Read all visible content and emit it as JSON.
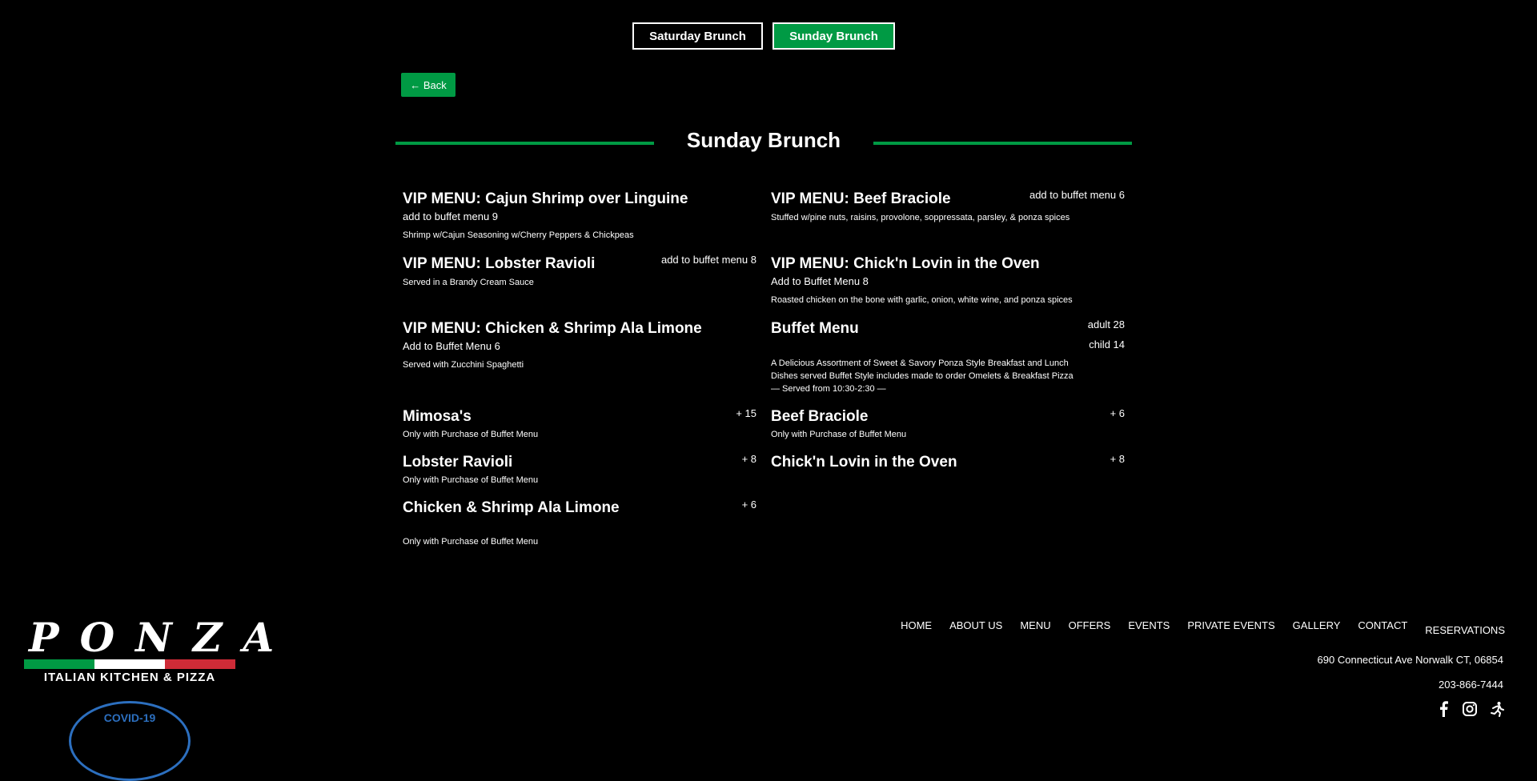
{
  "tabs": {
    "saturday": "Saturday Brunch",
    "sunday": "Sunday Brunch"
  },
  "back_label": "← Back",
  "page_title": "Sunday Brunch",
  "items": {
    "cajun": {
      "title": "VIP MENU: Cajun Shrimp over Linguine",
      "sub": "add to buffet menu  9",
      "desc": "Shrimp w/Cajun Seasoning w/Cherry Peppers & Chickpeas"
    },
    "beef_vip": {
      "title": "VIP MENU: Beef Braciole",
      "price": "add to buffet menu  6",
      "desc": "Stuffed w/pine nuts, raisins, provolone, soppressata, parsley, & ponza spices"
    },
    "lobster_vip": {
      "title": "VIP MENU: Lobster Ravioli",
      "price": "add to buffet menu  8",
      "desc": "Served in a Brandy Cream Sauce"
    },
    "chickn_vip": {
      "title": "VIP MENU: Chick'n Lovin in the Oven",
      "sub": "Add to Buffet Menu  8",
      "desc": "Roasted chicken on the bone with garlic, onion, white wine, and ponza spices"
    },
    "limone_vip": {
      "title": "VIP MENU: Chicken & Shrimp Ala Limone",
      "sub": "Add to Buffet Menu  6",
      "desc": "Served with Zucchini Spaghetti"
    },
    "buffet": {
      "title": "Buffet Menu",
      "adult": "adult  28",
      "child": "child  14",
      "desc_1": "A Delicious Assortment of Sweet & Savory Ponza Style Breakfast and Lunch",
      "desc_2": "Dishes served Buffet Style includes made to order Omelets & Breakfast Pizza",
      "desc_3": "— Served from 10:30-2:30 —"
    },
    "mimosa": {
      "title": "Mimosa's",
      "price": "+  15",
      "desc": "Only with Purchase of Buffet Menu"
    },
    "beef": {
      "title": "Beef Braciole",
      "price": "+  6",
      "desc": "Only with Purchase of Buffet Menu"
    },
    "lobster": {
      "title": "Lobster Ravioli",
      "price": "+  8",
      "desc": "Only with Purchase of Buffet Menu"
    },
    "chickn": {
      "title": "Chick'n Lovin in the Oven",
      "price": "+  8"
    },
    "limone": {
      "title": "Chicken & Shrimp Ala Limone",
      "price": "+  6",
      "desc": "Only with Purchase of Buffet Menu"
    }
  },
  "footer": {
    "logo_word": "PONZA",
    "logo_tag": "ITALIAN KITCHEN & PIZZA",
    "covid_badge": "COVID-19",
    "nav": [
      "HOME",
      "ABOUT US",
      "MENU",
      "OFFERS",
      "EVENTS",
      "PRIVATE EVENTS",
      "GALLERY",
      "CONTACT",
      "RESERVATIONS"
    ],
    "address": "690 Connecticut Ave Norwalk CT, 06854",
    "phone": "203-866-7444",
    "social_icons": [
      "facebook-icon",
      "instagram-icon",
      "running-person-icon"
    ]
  },
  "colors": {
    "accent_green": "#009a44",
    "background": "#000000",
    "flag_red": "#ce2b37",
    "covid_blue": "#2c6fbf"
  }
}
